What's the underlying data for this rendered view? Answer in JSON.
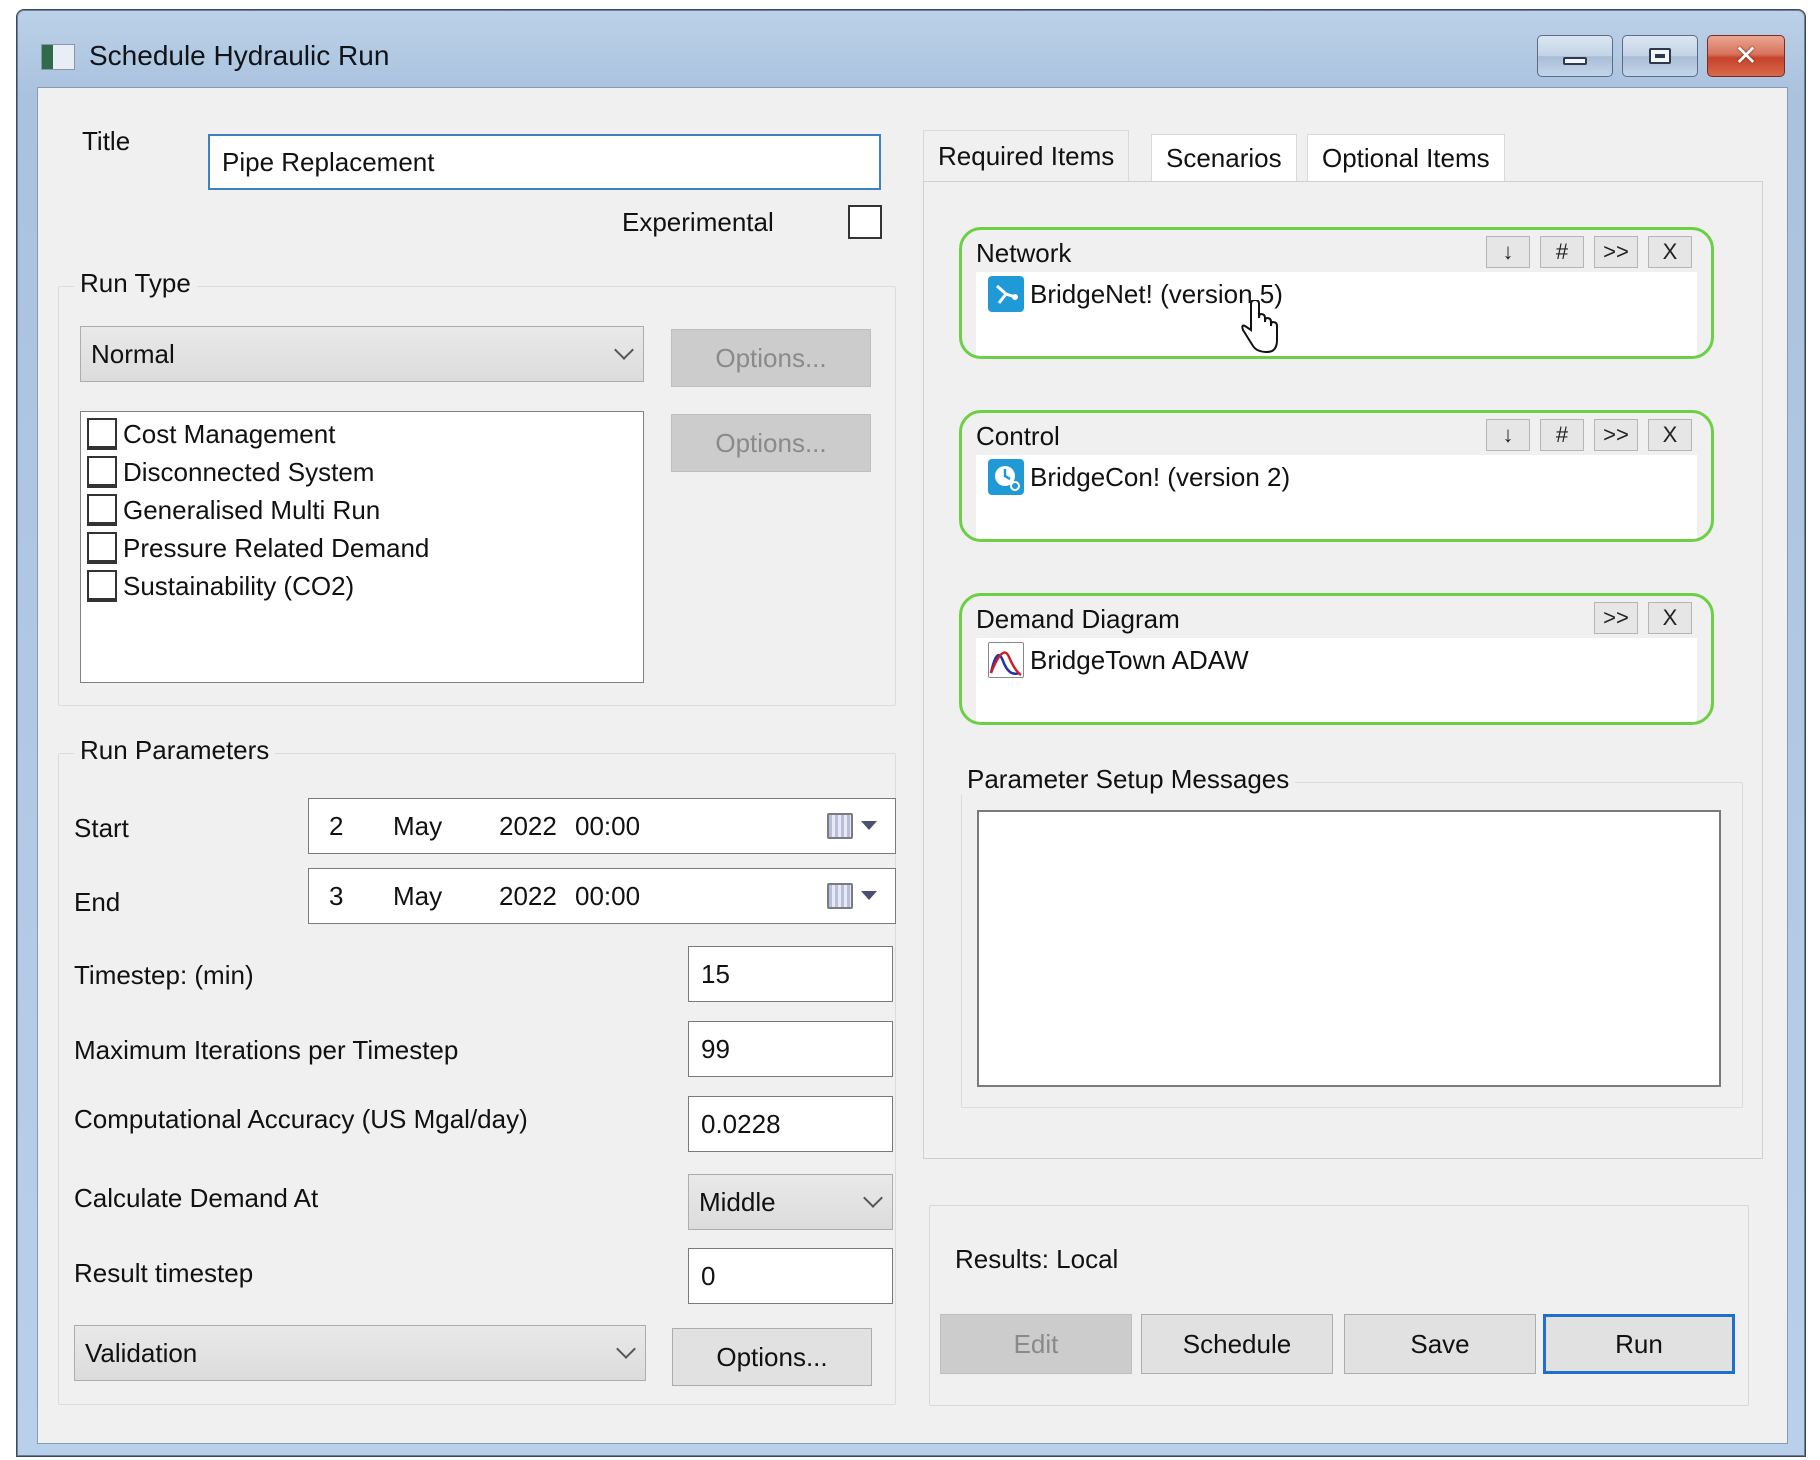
{
  "window": {
    "title": "Schedule Hydraulic Run",
    "controls": {
      "minimize": "minimize",
      "maximize": "maximize",
      "close": "close"
    }
  },
  "form": {
    "title_label": "Title",
    "title_value": "Pipe Replacement",
    "experimental_label": "Experimental",
    "experimental_checked": false
  },
  "run_type": {
    "group_label": "Run Type",
    "selected": "Normal",
    "options_button": "Options...",
    "list_options_button": "Options...",
    "options": [
      {
        "label": "Cost Management",
        "checked": false
      },
      {
        "label": "Disconnected System",
        "checked": false
      },
      {
        "label": "Generalised Multi Run",
        "checked": false
      },
      {
        "label": "Pressure Related Demand",
        "checked": false
      },
      {
        "label": "Sustainability (CO2)",
        "checked": false
      }
    ]
  },
  "run_parameters": {
    "group_label": "Run Parameters",
    "start": {
      "label": "Start",
      "day": "2",
      "month": "May",
      "year": "2022",
      "time": "00:00"
    },
    "end": {
      "label": "End",
      "day": "3",
      "month": "May",
      "year": "2022",
      "time": "00:00"
    },
    "timestep": {
      "label": "Timestep: (min)",
      "value": "15"
    },
    "max_iterations": {
      "label": "Maximum Iterations per Timestep",
      "value": "99"
    },
    "accuracy": {
      "label": "Computational Accuracy (US Mgal/day)",
      "value": "0.0228"
    },
    "calc_demand": {
      "label": "Calculate Demand At",
      "selected": "Middle"
    },
    "result_timestep": {
      "label": "Result timestep",
      "value": "0"
    },
    "validation": {
      "selected": "Validation",
      "options_button": "Options..."
    }
  },
  "tabs": [
    {
      "label": "Required Items",
      "active": true
    },
    {
      "label": "Scenarios",
      "active": false
    },
    {
      "label": "Optional Items",
      "active": false
    }
  ],
  "required_items": [
    {
      "title": "Network",
      "item": "BridgeNet! (version 5)",
      "icon": "network-icon",
      "buttons": [
        "↓",
        "#",
        ">>",
        "X"
      ]
    },
    {
      "title": "Control",
      "item": "BridgeCon! (version 2)",
      "icon": "control-clock-icon",
      "buttons": [
        "↓",
        "#",
        ">>",
        "X"
      ]
    },
    {
      "title": "Demand Diagram",
      "item": "BridgeTown ADAW",
      "icon": "demand-diagram-icon",
      "buttons": [
        ">>",
        "X"
      ]
    }
  ],
  "messages": {
    "group_label": "Parameter Setup Messages",
    "items": []
  },
  "results": {
    "label": "Results: Local",
    "buttons": {
      "edit": "Edit",
      "schedule": "Schedule",
      "save": "Save",
      "run": "Run"
    }
  },
  "colors": {
    "accent_green": "#6ccf44",
    "focus_blue": "#1e6fd0",
    "close_red": "#c5432a"
  }
}
